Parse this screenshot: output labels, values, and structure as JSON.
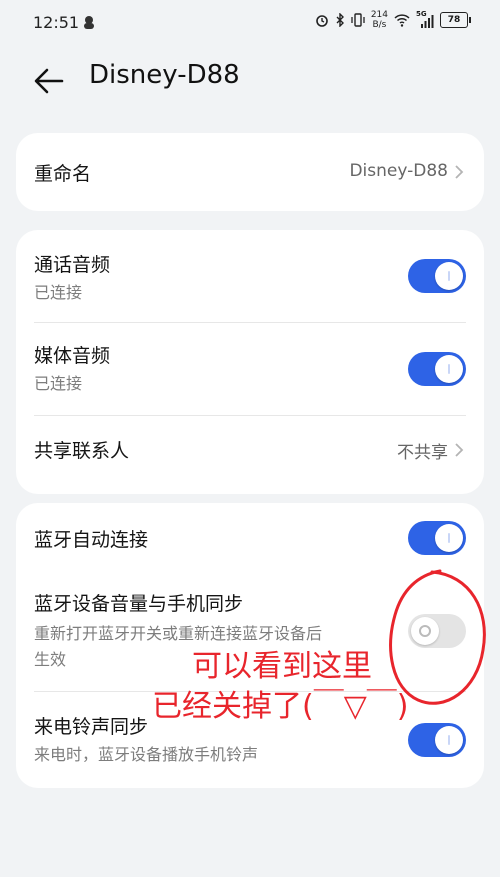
{
  "status_bar": {
    "time": "12:51",
    "net_speed_value": "214",
    "net_speed_unit": "B/s",
    "network": "5G",
    "battery": "78"
  },
  "header": {
    "title": "Disney-D88"
  },
  "rename": {
    "label": "重命名",
    "value": "Disney-D88"
  },
  "call_audio": {
    "title": "通话音频",
    "subtitle": "已连接",
    "enabled": true
  },
  "media_audio": {
    "title": "媒体音频",
    "subtitle": "已连接",
    "enabled": true
  },
  "share_contacts": {
    "title": "共享联系人",
    "value": "不共享"
  },
  "auto_connect": {
    "title": "蓝牙自动连接",
    "enabled": true
  },
  "volume_sync": {
    "title": "蓝牙设备音量与手机同步",
    "subtitle_line1": "重新打开蓝牙开关或重新连接蓝牙设备后",
    "subtitle_line2": "生效",
    "enabled": false
  },
  "ringtone_sync": {
    "title": "来电铃声同步",
    "subtitle": "来电时，蓝牙设备播放手机铃声",
    "enabled": true
  },
  "annotation": {
    "line1": "可以看到这里",
    "line2": "已经关掉了(￣▽￣)",
    "color": "#e8252c"
  },
  "colors": {
    "toggle_on": "#2e63e6",
    "toggle_off": "#e4e4e4",
    "background": "#f1f3f5"
  }
}
